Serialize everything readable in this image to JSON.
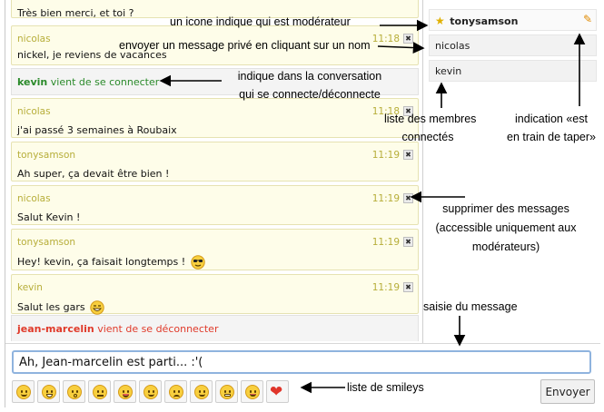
{
  "messages": [
    {
      "nick": "",
      "time": "",
      "text": "Très bien merci, et toi ?"
    },
    {
      "nick": "nicolas",
      "time": "11:18",
      "text": "nickel, je reviens de vacances"
    },
    {
      "nick": "nicolas",
      "time": "11:18",
      "text": "j'ai passé 3 semaines à Roubaix"
    },
    {
      "nick": "tonysamson",
      "time": "11:19",
      "text": "Ah super, ça devait être bien !"
    },
    {
      "nick": "nicolas",
      "time": "11:19",
      "text": "Salut Kevin !"
    },
    {
      "nick": "tonysamson",
      "time": "11:19",
      "text": "Hey! kevin, ça faisait longtemps !"
    },
    {
      "nick": "kevin",
      "time": "11:19",
      "text": "Salut les gars"
    }
  ],
  "system_messages": [
    {
      "user": "kevin",
      "action": "vient de se connecter",
      "color": "#2a8a2a"
    },
    {
      "user": "jean-marcelin",
      "action": "vient de se déconnecter",
      "color": "#e03a2a"
    }
  ],
  "members": [
    "tonysamson",
    "nicolas",
    "kevin"
  ],
  "input": {
    "value": "Ah, Jean-marcelin est parti... :'("
  },
  "send_label": "Envoyer",
  "smileys": [
    "smile",
    "laugh",
    "surprised",
    "neutral",
    "tongue",
    "cool",
    "sad",
    "happy",
    "grin",
    "wink",
    "heart"
  ],
  "annotations": {
    "moderator": "un icone indique qui est modérateur",
    "private": "envoyer un message privé en cliquant sur un nom",
    "connect_1": "indique dans la conversation",
    "connect_2": "qui se connecte/déconnecte",
    "members_1": "liste des membres",
    "members_2": "connectés",
    "typing_1": "indication «est",
    "typing_2": "en train de taper»",
    "delete_1": "supprimer des messages",
    "delete_2": "(accessible uniquement aux",
    "delete_3": "modérateurs)",
    "input": "saisie du message",
    "smileys": "liste de smileys"
  },
  "colors": {
    "accent": "#8fb3de",
    "nick": "#b7ae3a",
    "join": "#2a8a2a",
    "leave": "#e03a2a"
  }
}
